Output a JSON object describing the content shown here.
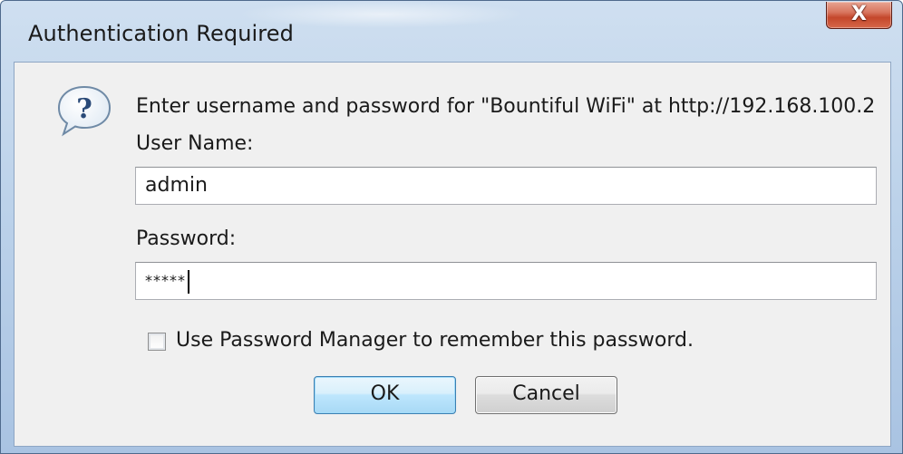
{
  "dialog": {
    "title": "Authentication Required",
    "close_label": "X",
    "prompt": "Enter username and password for \"Bountiful WiFi\" at http://192.168.100.2",
    "help_icon": "question-speech-bubble-icon"
  },
  "form": {
    "username_label": "User Name:",
    "username_value": "admin",
    "password_label": "Password:",
    "password_value": "*****",
    "remember_label": "Use Password Manager to remember this password.",
    "remember_checked": false
  },
  "buttons": {
    "ok_label": "OK",
    "cancel_label": "Cancel"
  },
  "colors": {
    "title_bar": "#bcd2ea",
    "close_button": "#c4472b",
    "client_background": "#f0f0f0",
    "default_button_border": "#3c7fb1"
  }
}
